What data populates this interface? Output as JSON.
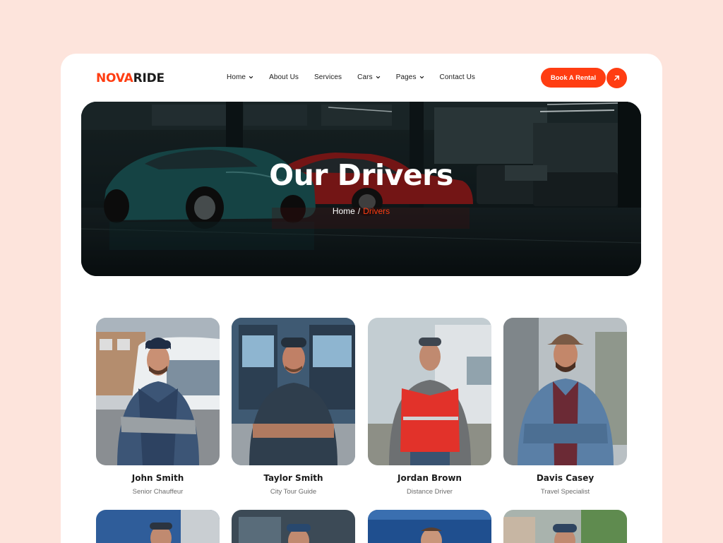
{
  "brand": {
    "part1": "NOVA",
    "part2": "RIDE"
  },
  "nav": [
    {
      "label": "Home",
      "dropdown": true
    },
    {
      "label": "About Us",
      "dropdown": false
    },
    {
      "label": "Services",
      "dropdown": false
    },
    {
      "label": "Cars",
      "dropdown": true
    },
    {
      "label": "Pages",
      "dropdown": true
    },
    {
      "label": "Contact Us",
      "dropdown": false
    }
  ],
  "cta": {
    "label": "Book A Rental",
    "icon": "arrow-up-right-icon"
  },
  "hero": {
    "title": "Our Drivers",
    "breadcrumb": {
      "home": "Home",
      "separator": "/",
      "current": "Drivers"
    }
  },
  "drivers": [
    {
      "name": "John Smith",
      "role": "Senior Chauffeur"
    },
    {
      "name": "Taylor Smith",
      "role": "City Tour Guide"
    },
    {
      "name": "Jordan Brown",
      "role": "Distance Driver"
    },
    {
      "name": "Davis Casey",
      "role": "Travel Specialist"
    }
  ],
  "colors": {
    "accent": "#ff3d12",
    "page_bg": "#fde4dc",
    "card_bg": "#ffffff",
    "text": "#1b1b1b",
    "muted": "#6b6b6b"
  }
}
